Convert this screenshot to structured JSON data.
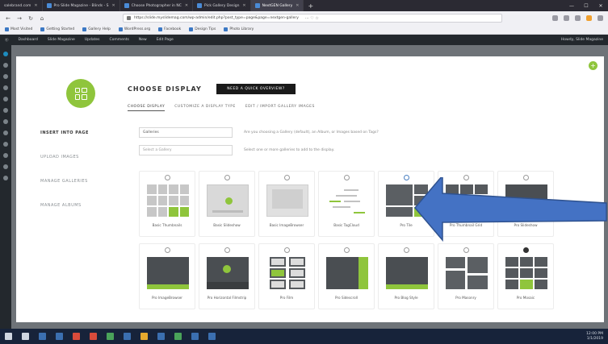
{
  "browser": {
    "tabs": [
      {
        "label": "salebrand.com"
      },
      {
        "label": "Pro Slide Magazine - Blinds - S"
      },
      {
        "label": "Choose Photographer in NC"
      },
      {
        "label": "Pick Gallery Design"
      },
      {
        "label": "NextGEN Gallery"
      }
    ],
    "url": "https://slide.myslidemag.com/wp-admin/edit.php?post_type=page&page=nextgen-gallery",
    "bookmarks": [
      "Most Visited",
      "Getting Started",
      "Gallery Help",
      "WordPress.org",
      "Facebook",
      "Design Tips",
      "Photo Library"
    ]
  },
  "adminbar": {
    "items": [
      "Dashboard",
      "Slide Magazine",
      "Updates",
      "Comments",
      "New",
      "Edit Page"
    ],
    "howdy": "Howdy, Slide Magazine"
  },
  "modal": {
    "title": "CHOOSE DISPLAY",
    "quick_button": "NEED A QUICK OVERVIEW?",
    "close_icon": "plus-icon",
    "nav": [
      {
        "label": "INSERT INTO PAGE",
        "active": true
      },
      {
        "label": "UPLOAD IMAGES",
        "active": false
      },
      {
        "label": "MANAGE GALLERIES",
        "active": false
      },
      {
        "label": "MANAGE ALBUMS",
        "active": false
      }
    ],
    "subtabs": [
      {
        "label": "CHOOSE DISPLAY",
        "active": true
      },
      {
        "label": "CUSTOMIZE A DISPLAY TYPE",
        "active": false
      },
      {
        "label": "EDIT / IMPORT GALLERY IMAGES",
        "active": false
      }
    ],
    "gallery_field": "Galleries",
    "gallery_help": "Are you choosing a Gallery (default), an Album, or Images based on Tags?",
    "search_placeholder": "Select a Gallery",
    "search_help": "Select one or more galleries to add to the display.",
    "displays": [
      {
        "label": "Basic Thumbnails"
      },
      {
        "label": "Basic Slideshow"
      },
      {
        "label": "Basic ImageBrowser"
      },
      {
        "label": "Basic TagCloud"
      },
      {
        "label": "Pro Tile"
      },
      {
        "label": "Pro Thumbnail Grid"
      },
      {
        "label": "Pro Slideshow"
      },
      {
        "label": "Pro ImageBrowser"
      },
      {
        "label": "Pro Horizontal Filmstrip"
      },
      {
        "label": "Pro Film"
      },
      {
        "label": "Pro Sidescroll"
      },
      {
        "label": "Pro Blog Style"
      },
      {
        "label": "Pro Masonry"
      },
      {
        "label": "Pro Mosaic"
      }
    ],
    "selected_display": "Pro Tile"
  },
  "annotation": {
    "arrow_color": "#4472c4",
    "points_to": "Pro Tile"
  },
  "taskbar": {
    "time": "12:00 PM",
    "date": "1/1/2019"
  },
  "colors": {
    "accent_green": "#8fc53c",
    "arrow_blue": "#4472c4",
    "admin_bar": "#23282d"
  }
}
